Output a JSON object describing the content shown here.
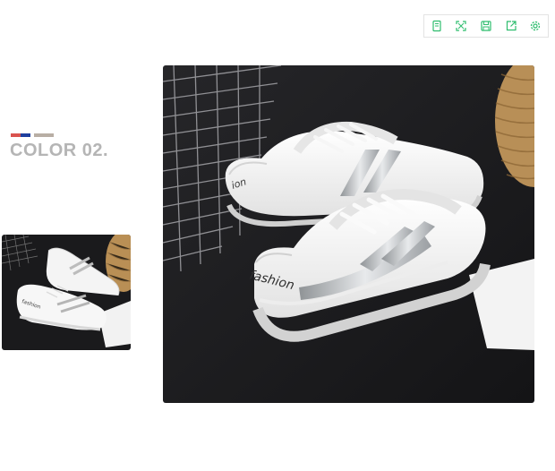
{
  "toolbar": {
    "items": [
      {
        "icon": "copy-icon"
      },
      {
        "icon": "expand-icon"
      },
      {
        "icon": "save-icon"
      },
      {
        "icon": "share-icon"
      },
      {
        "icon": "settings-icon"
      }
    ],
    "accent": "#2ebd6e"
  },
  "color_option": {
    "label": "COLOR 02.",
    "swatch_colors": [
      "#d9534f",
      "#1f3f9e",
      "#b8aea4"
    ]
  },
  "photos": {
    "thumbnail_text": "fashion",
    "main_text": "fashion"
  }
}
